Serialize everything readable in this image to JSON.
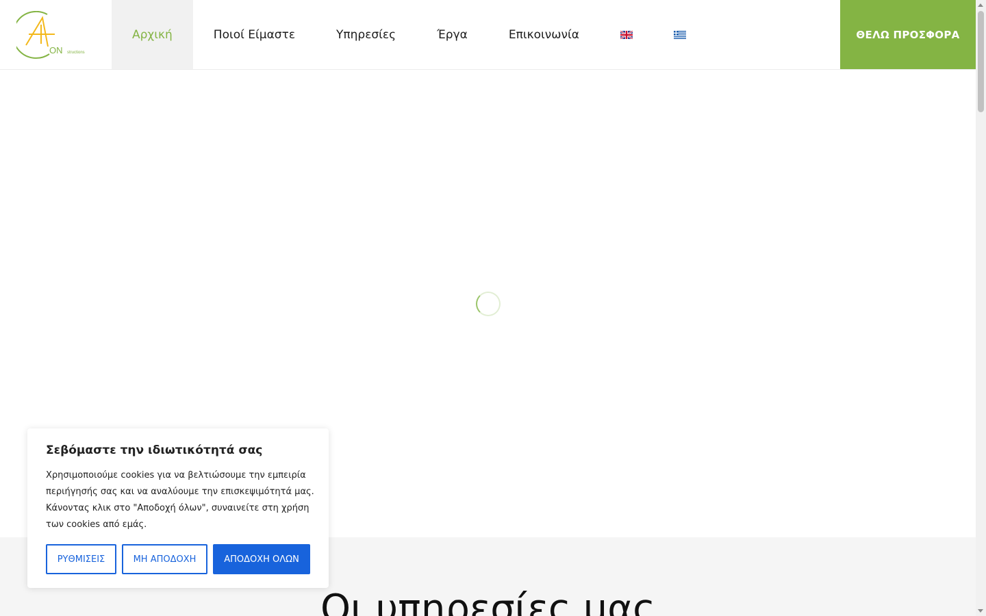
{
  "colors": {
    "accent_green": "#84b444",
    "logo_yellow": "#f3b81a",
    "cookie_blue": "#1863dc",
    "section_gray": "#f5f5f5"
  },
  "logo": {
    "main": "ON",
    "sub": "structions"
  },
  "nav": {
    "items": [
      {
        "label": "Αρχική",
        "active": true
      },
      {
        "label": "Ποιοί Είμαστε"
      },
      {
        "label": "Υπηρεσίες"
      },
      {
        "label": "Έργα"
      },
      {
        "label": "Επικοινωνία"
      }
    ],
    "flags": [
      "uk-flag-icon",
      "greece-flag-icon"
    ]
  },
  "cta": {
    "label": "ΘΕΛΩ ΠΡΟΣΦΟΡΑ"
  },
  "services": {
    "title": "Οι υπηρεσίες μας"
  },
  "cookie": {
    "title": "Σεβόμαστε την ιδιωτικότητά σας",
    "text": "Χρησιμοποιούμε cookies για να βελτιώσουμε την εμπειρία περιήγησής σας και να αναλύουμε την επισκεψιμότητά μας. Κάνοντας κλικ στο \"Αποδοχή όλων\", συναινείτε στη χρήση των cookies από εμάς.",
    "settings_label": "ΡΥΘΜΙΣΕΙΣ",
    "reject_label": "ΜΗ ΑΠΟΔΟΧΗ",
    "accept_label": "ΑΠΟΔΟΧΗ ΟΛΩΝ"
  }
}
